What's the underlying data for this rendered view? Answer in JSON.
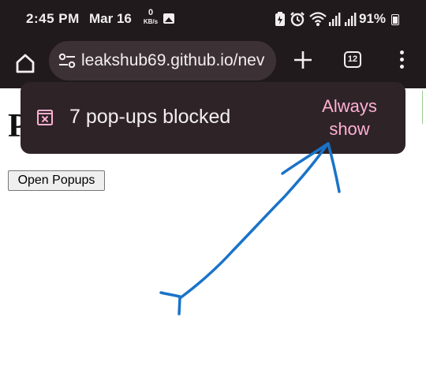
{
  "status_bar": {
    "time": "2:45 PM",
    "date": "Mar 16",
    "net_speed_value": "0",
    "net_speed_unit": "KB/s",
    "battery_percent": "91%",
    "icons": [
      "gallery-icon",
      "battery-saver-icon",
      "alarm-icon",
      "wifi-icon",
      "signal-icon",
      "signal-icon",
      "battery-icon"
    ]
  },
  "toolbar": {
    "url": "leakshub69.github.io/nev",
    "tab_count": "12",
    "icons": [
      "home-icon",
      "tune-icon",
      "plus-icon",
      "tab-switcher-icon",
      "more-vert-icon"
    ]
  },
  "popup_bar": {
    "message": "7 pop-ups blocked",
    "action_line1": "Always",
    "action_line2": "show",
    "icon": "popup-blocked-icon"
  },
  "page": {
    "heading": "P",
    "button_label": "Open Popups"
  },
  "colors": {
    "chrome_bg": "#211a1d",
    "omnibox_bg": "#3c3236",
    "popup_bg": "#2e2428",
    "accent_pink": "#ffb0d1",
    "annotation_blue": "#1a73c8"
  }
}
